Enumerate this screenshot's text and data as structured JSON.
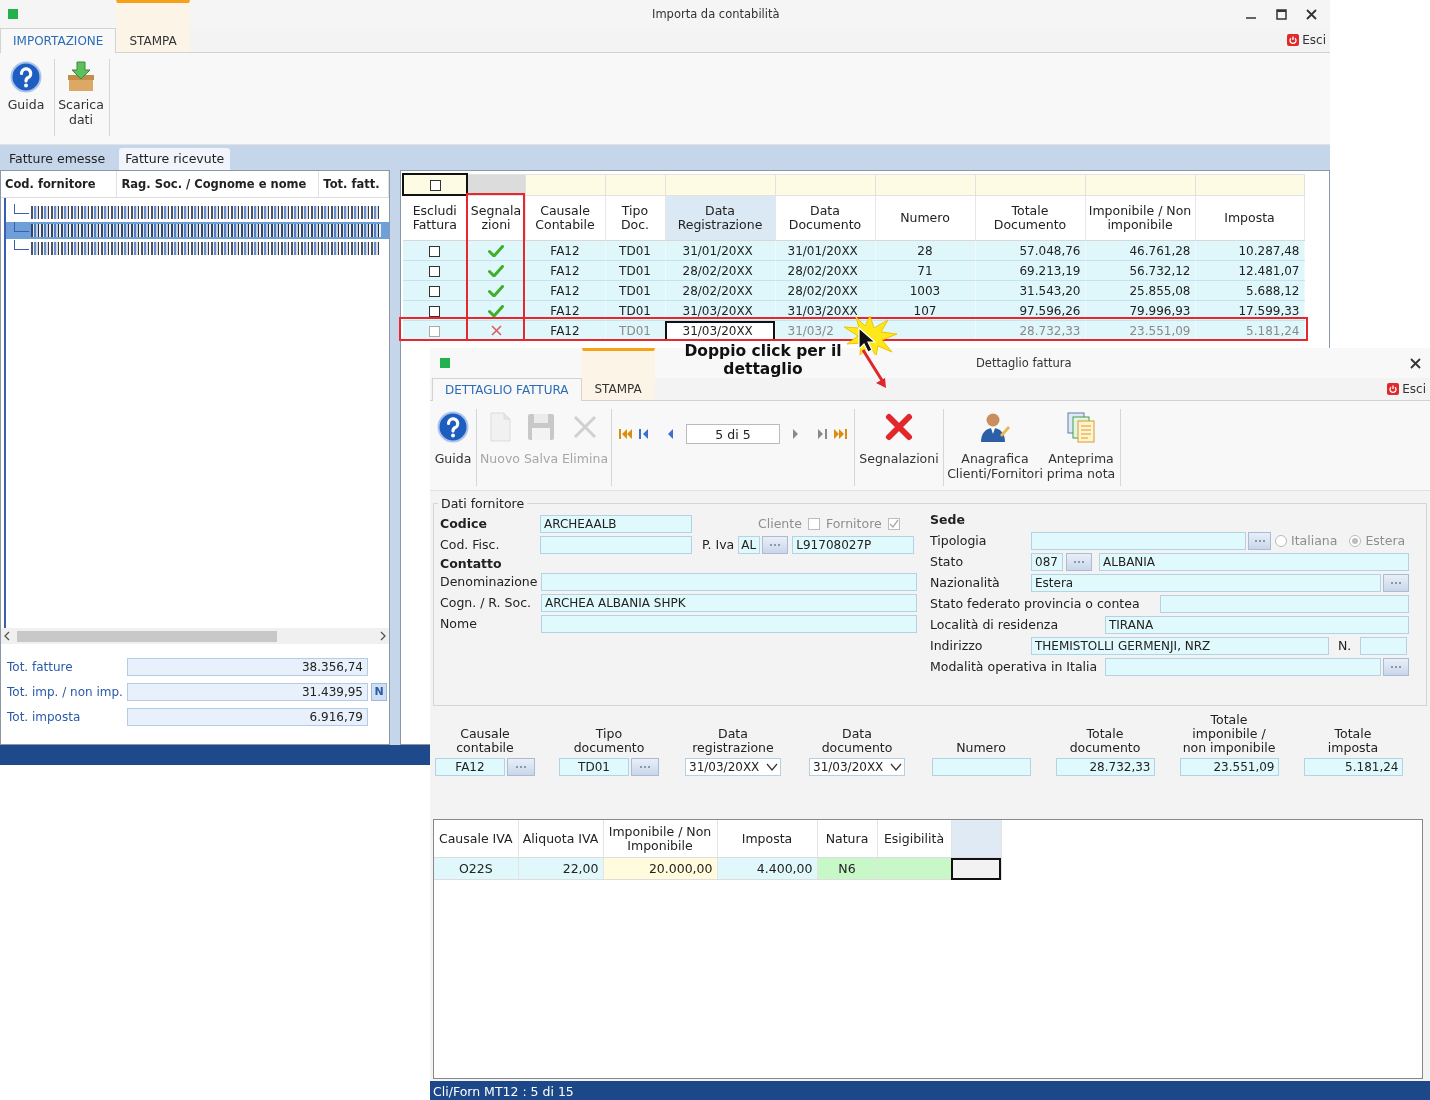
{
  "main_window": {
    "title": "Importa da contabilità",
    "ribbon_tabs": [
      {
        "label": "IMPORTAZIONE",
        "selected": true,
        "contextual": false
      },
      {
        "label": "STAMPA",
        "selected": false,
        "contextual": true
      }
    ],
    "exit_button": "Esci",
    "ribbon_buttons": [
      {
        "label": "Guida",
        "kind": "help"
      },
      {
        "label": "Scarica dati",
        "kind": "download"
      }
    ]
  },
  "invoice_tabs": [
    {
      "label": "Fatture emesse",
      "selected": false
    },
    {
      "label": "Fatture ricevute",
      "selected": true
    }
  ],
  "supplier_tree": {
    "columns": [
      "Cod. fornitore",
      "Rag. Soc. / Cognome e nome",
      "Tot. fatt."
    ],
    "rows": [
      {
        "selected": false
      },
      {
        "selected": true
      },
      {
        "selected": false
      }
    ]
  },
  "totals": [
    {
      "label": "Tot. fatture",
      "value": "38.356,74"
    },
    {
      "label": "Tot. imp. / non imp.",
      "value": "31.439,95",
      "button": "N"
    },
    {
      "label": "Tot. imposta",
      "value": "6.916,79"
    }
  ],
  "invoice_grid": {
    "select_all_checked": false,
    "columns": [
      {
        "label": "Escludi\nFattura",
        "sorted": false
      },
      {
        "label": "Segnala\nzioni",
        "sorted": false
      },
      {
        "label": "Causale\nContabile",
        "sorted": false
      },
      {
        "label": "Tipo\nDoc.",
        "sorted": false
      },
      {
        "label": "Data\nRegistrazione",
        "sorted": true
      },
      {
        "label": "Data\nDocumento",
        "sorted": false
      },
      {
        "label": "Numero",
        "sorted": false
      },
      {
        "label": "Totale\nDocumento",
        "sorted": false
      },
      {
        "label": "Imponibile / Non\nimponibile",
        "sorted": false
      },
      {
        "label": "Imposta",
        "sorted": false
      }
    ],
    "rows": [
      {
        "excluded": false,
        "ok": true,
        "focused": false,
        "cells": [
          null,
          null,
          "FA12",
          "TD01",
          "31/01/20XX",
          "31/01/20XX",
          "28",
          "57.048,76",
          "46.761,28",
          "10.287,48"
        ]
      },
      {
        "excluded": false,
        "ok": true,
        "focused": false,
        "cells": [
          null,
          null,
          "FA12",
          "TD01",
          "28/02/20XX",
          "28/02/20XX",
          "71",
          "69.213,19",
          "56.732,12",
          "12.481,07"
        ]
      },
      {
        "excluded": false,
        "ok": true,
        "focused": false,
        "cells": [
          null,
          null,
          "FA12",
          "TD01",
          "28/02/20XX",
          "28/02/20XX",
          "1003",
          "31.543,20",
          "25.855,08",
          "5.688,12"
        ]
      },
      {
        "excluded": false,
        "ok": true,
        "focused": false,
        "cells": [
          null,
          null,
          "FA12",
          "TD01",
          "31/03/20XX",
          "31/03/20XX",
          "107",
          "97.596,26",
          "79.996,93",
          "17.599,33"
        ]
      },
      {
        "excluded": false,
        "ok": false,
        "focused": true,
        "cells": [
          null,
          null,
          "FA12",
          "TD01",
          "31/03/20XX",
          "31/03/2",
          null,
          "28.732,33",
          "23.551,09",
          "5.181,24"
        ]
      }
    ]
  },
  "annotation": {
    "text": "Doppio click per il dettaglio"
  },
  "detail_dialog": {
    "title": "Dettaglio fattura",
    "tabs": [
      {
        "label": "DETTAGLIO FATTURA",
        "selected": true,
        "contextual": false
      },
      {
        "label": "STAMPA",
        "selected": false,
        "contextual": true
      }
    ],
    "exit_button": "Esci",
    "toolbar_groups": [
      {
        "items": [
          {
            "kind": "help",
            "label": "Guida",
            "disabled": false
          }
        ]
      },
      {
        "items": [
          {
            "kind": "new",
            "label": "Nuovo",
            "disabled": true
          },
          {
            "kind": "save",
            "label": "Salva",
            "disabled": true
          },
          {
            "kind": "delete",
            "label": "Elimina",
            "disabled": true
          }
        ]
      },
      {
        "items": [
          {
            "kind": "navigator",
            "value": "5 di 5"
          }
        ]
      },
      {
        "items": [
          {
            "kind": "alert",
            "label": "Segnalazioni",
            "disabled": false
          }
        ]
      },
      {
        "items": [
          {
            "kind": "person",
            "label": "Anagrafica Clienti/Fornitori",
            "disabled": false
          },
          {
            "kind": "pages",
            "label": "Anteprima prima nota",
            "disabled": false
          }
        ]
      }
    ],
    "supplier": {
      "title": "Dati fornitore",
      "codice_label": "Codice",
      "codice": "ARCHEAALB",
      "cliente_label": "Cliente",
      "cliente_checked": false,
      "fornitore_label": "Fornitore",
      "fornitore_checked": true,
      "cod_fisc_label": "Cod. Fisc.",
      "piva_label": "P. Iva",
      "piva_country": "AL",
      "piva": "L91708027P",
      "contatto_label": "Contatto",
      "denominazione_label": "Denominazione",
      "cognome_label": "Cogn. / R. Soc.",
      "cognome": "ARCHEA ALBANIA SHPK",
      "nome_label": "Nome"
    },
    "sede": {
      "title": "Sede",
      "tipologia_label": "Tipologia",
      "options": [
        {
          "label": "Italiana",
          "selected": false
        },
        {
          "label": "Estera",
          "selected": true
        }
      ],
      "stato_label": "Stato",
      "stato_code": "087",
      "stato": "ALBANIA",
      "nazionalita_label": "Nazionalità",
      "nazionalita": "Estera",
      "stato_federato_label": "Stato federato provincia o contea",
      "localita_label": "Località di residenza",
      "localita": "TIRANA",
      "indirizzo_label": "Indirizzo",
      "indirizzo": "THEMISTOLLI GERMENJI, NRZ",
      "numero_label": "N.",
      "modalita_label": "Modalità operativa in Italia"
    },
    "document_fields": [
      {
        "label": "Causale\ncontabile",
        "value": "FA12",
        "kind": "lookup"
      },
      {
        "label": "Tipo documento",
        "value": "TD01",
        "kind": "lookup"
      },
      {
        "label": "Data\nregistrazione",
        "value": "31/03/20XX",
        "kind": "date"
      },
      {
        "label": "Data\ndocumento",
        "value": "31/03/20XX",
        "kind": "date"
      },
      {
        "label": "Numero",
        "kind": "text"
      },
      {
        "label": "Totale\ndocumento",
        "value": "28.732,33",
        "kind": "amount"
      },
      {
        "label": "Totale\nimponibile /\nnon imponibile",
        "value": "23.551,09",
        "kind": "amount"
      },
      {
        "label": "Totale\nimposta",
        "value": "5.181,24",
        "kind": "amount"
      }
    ],
    "vat_grid": {
      "columns": [
        "Causale IVA",
        "Aliquota IVA",
        "Imponibile / Non\nImponibile",
        "Imposta",
        "Natura",
        "Esigibilità"
      ],
      "rows": [
        {
          "cells": [
            "O22S",
            "22,00",
            "20.000,00",
            "4.400,00",
            "N6",
            null
          ]
        }
      ]
    },
    "status_bar": "Cli/Forn MT12 : 5 di 15"
  }
}
